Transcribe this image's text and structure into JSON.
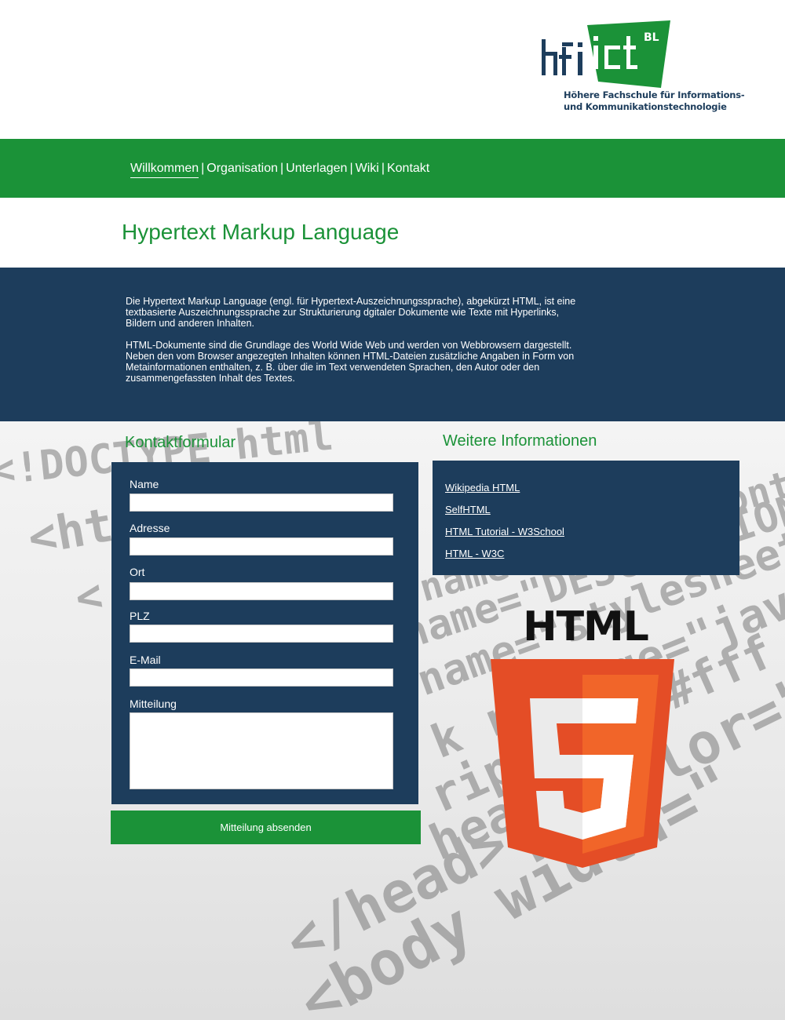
{
  "header": {
    "logo": {
      "mark_text": "hfict",
      "badge": "BL",
      "subtitle_line1": "Höhere Fachschule für Informations-",
      "subtitle_line2": "und Kommunikationstechnologie"
    }
  },
  "nav": {
    "items": [
      {
        "label": "Willkommen",
        "active": true
      },
      {
        "label": "Organisation"
      },
      {
        "label": "Unterlagen"
      },
      {
        "label": "Wiki"
      },
      {
        "label": "Kontakt"
      }
    ],
    "separator": "|"
  },
  "page": {
    "title": "Hypertext Markup Language",
    "intro": [
      "Die Hypertext Markup Language (engl. für Hypertext-Auszeichnungssprache), abgekürzt HTML, ist eine textbasierte Auszeichnungssprache zur Strukturierung dgitaler Dokumente wie Texte mit Hyperlinks, Bildern und anderen Inhalten.",
      "HTML-Dokumente sind die Grundlage des World Wide Web und werden von Webbrowsern dargestellt. Neben den vom Browser angezegten Inhalten können HTML-Dateien zusätzliche Angaben in Form von Metainformationen enthalten, z. B. über die im Text verwendeten Sprachen, den Autor oder den zusammengefassten Inhalt des Textes."
    ]
  },
  "contact": {
    "title": "Kontaktformular",
    "fields": {
      "name": {
        "label": "Name",
        "value": ""
      },
      "address": {
        "label": "Adresse",
        "value": ""
      },
      "city": {
        "label": "Ort",
        "value": ""
      },
      "zip": {
        "label": "PLZ",
        "value": ""
      },
      "email": {
        "label": "E-Mail",
        "value": ""
      },
      "message": {
        "label": "Mitteilung",
        "value": ""
      }
    },
    "submit_label": "Mitteilung absenden"
  },
  "info": {
    "title": "Weitere Informationen",
    "links": [
      {
        "label": "Wikipedia HTML"
      },
      {
        "label": "SelfHTML"
      },
      {
        "label": "HTML Tutorial - W3School"
      },
      {
        "label": "HTML - W3C"
      }
    ]
  },
  "html5_logo": {
    "word": "HTML",
    "digit": "5"
  },
  "colors": {
    "green": "#1b9238",
    "navy": "#1d3d5c",
    "html5_orange": "#e44d26",
    "html5_orange_light": "#f16529"
  }
}
